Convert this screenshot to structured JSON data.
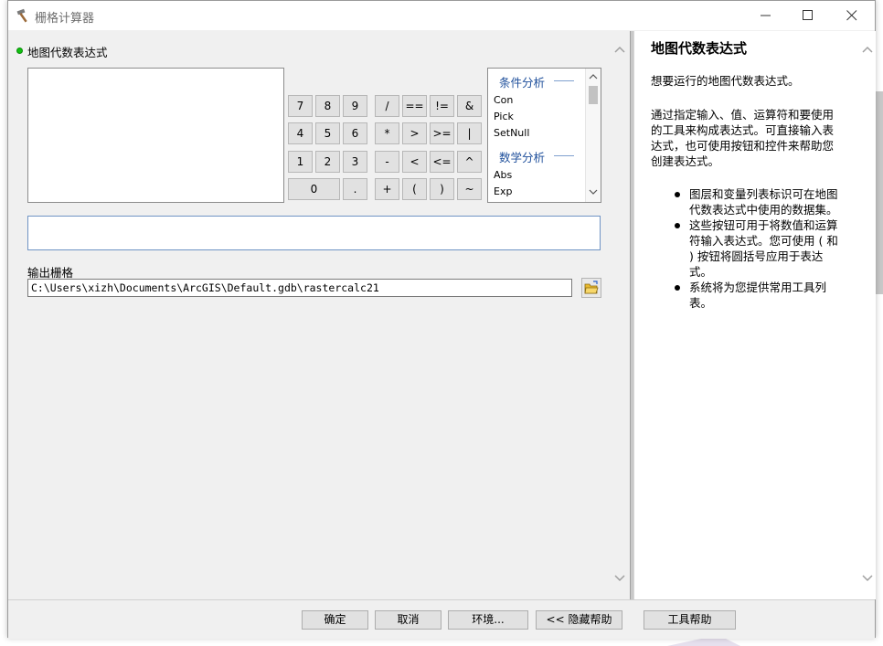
{
  "window": {
    "title": "栅格计算器"
  },
  "expression": {
    "label": "地图代数表达式",
    "value": ""
  },
  "calculator": {
    "digits": [
      "7",
      "8",
      "9",
      "4",
      "5",
      "6",
      "1",
      "2",
      "3",
      "0",
      "."
    ],
    "operators": [
      "/",
      "==",
      "!=",
      "&",
      "*",
      ">",
      ">=",
      "|",
      "-",
      "<",
      "<=",
      "^",
      "+",
      "(",
      ")",
      "~"
    ]
  },
  "functions": {
    "cat1": "条件分析",
    "cat1_items": [
      "Con",
      "Pick",
      "SetNull"
    ],
    "cat2": "数学分析",
    "cat2_items": [
      "Abs",
      "Exp"
    ]
  },
  "output": {
    "label": "输出栅格",
    "path": "C:\\Users\\xizh\\Documents\\ArcGIS\\Default.gdb\\rastercalc21"
  },
  "help": {
    "title": "地图代数表达式",
    "p1": "想要运行的地图代数表达式。",
    "p2": "通过指定输入、值、运算符和要使用的工具来构成表达式。可直接输入表达式，也可使用按钮和控件来帮助您创建表达式。",
    "bullets": [
      "图层和变量列表标识可在地图代数表达式中使用的数据集。",
      "这些按钮可用于将数值和运算符输入表达式。您可使用 ( 和 ) 按钮将圆括号应用于表达式。",
      "系统将为您提供常用工具列表。"
    ]
  },
  "buttons": {
    "ok": "确定",
    "cancel": "取消",
    "env": "环境...",
    "hide_help": "<< 隐藏帮助",
    "tool_help": "工具帮助"
  }
}
